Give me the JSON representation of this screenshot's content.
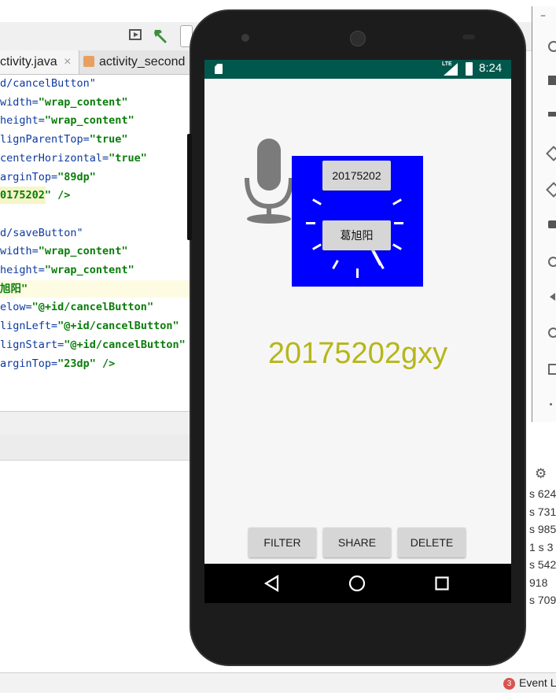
{
  "ide": {
    "tabs": [
      {
        "label": "ctivity.java",
        "close": "×"
      },
      {
        "label": "activity_second"
      }
    ],
    "code_lines": [
      {
        "a": "d/cancelButton\"",
        "v": ""
      },
      {
        "a": "width=",
        "v": "\"wrap_content\""
      },
      {
        "a": "height=",
        "v": "\"wrap_content\""
      },
      {
        "a": "lignParentTop=",
        "v": "\"true\""
      },
      {
        "a": "centerHorizontal=",
        "v": "\"true\""
      },
      {
        "a": "arginTop=",
        "v": "\"89dp\""
      },
      {
        "a": "",
        "v": "0175202\" />"
      },
      {
        "a": "",
        "v": ""
      },
      {
        "a": "d/saveButton\"",
        "v": ""
      },
      {
        "a": "width=",
        "v": "\"wrap_content\""
      },
      {
        "a": "height=",
        "v": "\"wrap_content\""
      },
      {
        "a": "",
        "v": "旭阳\""
      },
      {
        "a": "elow=",
        "v": "\"@+id/cancelButton\""
      },
      {
        "a": "lignLeft=",
        "v": "\"@+id/cancelButton\""
      },
      {
        "a": "lignStart=",
        "v": "\"@+id/cancelButton\""
      },
      {
        "a": "arginTop=",
        "v": "\"23dp\" />"
      }
    ],
    "right_bottom_lines": [
      "s 624",
      "s 731",
      "s 985",
      "1 s 3",
      "s 542",
      "918",
      "s 709"
    ],
    "event_log_count": "3",
    "event_log_label": "Event L",
    "window_minimize": "–"
  },
  "phone": {
    "status": {
      "time": "8:24",
      "network": "LTE"
    },
    "clock_button_top": "20175202",
    "clock_button_bottom": "葛旭阳",
    "big_text": "20175202gxy",
    "bottom_buttons": [
      "FILTER",
      "SHARE",
      "DELETE"
    ],
    "icons": [
      "mic-icon",
      "back-icon",
      "home-icon",
      "recents-icon",
      "sd-card-icon",
      "signal-icon",
      "battery-icon"
    ]
  },
  "colors": {
    "status_bar": "#00574b",
    "clock_bg": "#0000ff",
    "big_text": "#b6b61a",
    "code_attr": "#0d3aa0",
    "code_value": "#0a7d0a"
  }
}
